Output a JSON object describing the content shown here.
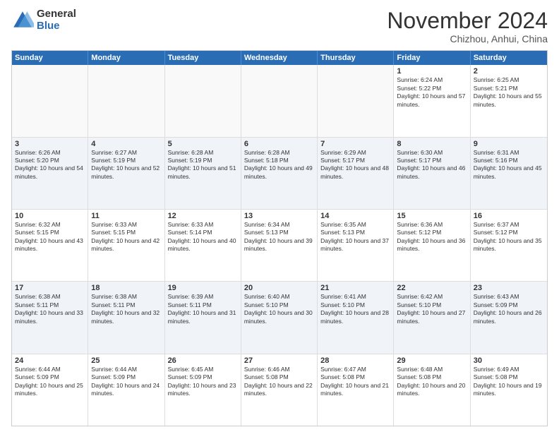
{
  "logo": {
    "general": "General",
    "blue": "Blue"
  },
  "title": "November 2024",
  "location": "Chizhou, Anhui, China",
  "days_of_week": [
    "Sunday",
    "Monday",
    "Tuesday",
    "Wednesday",
    "Thursday",
    "Friday",
    "Saturday"
  ],
  "weeks": [
    [
      {
        "day": "",
        "empty": true
      },
      {
        "day": "",
        "empty": true
      },
      {
        "day": "",
        "empty": true
      },
      {
        "day": "",
        "empty": true
      },
      {
        "day": "",
        "empty": true
      },
      {
        "day": "1",
        "sunrise": "6:24 AM",
        "sunset": "5:22 PM",
        "daylight": "10 hours and 57 minutes."
      },
      {
        "day": "2",
        "sunrise": "6:25 AM",
        "sunset": "5:21 PM",
        "daylight": "10 hours and 55 minutes."
      }
    ],
    [
      {
        "day": "3",
        "sunrise": "6:26 AM",
        "sunset": "5:20 PM",
        "daylight": "10 hours and 54 minutes."
      },
      {
        "day": "4",
        "sunrise": "6:27 AM",
        "sunset": "5:19 PM",
        "daylight": "10 hours and 52 minutes."
      },
      {
        "day": "5",
        "sunrise": "6:28 AM",
        "sunset": "5:19 PM",
        "daylight": "10 hours and 51 minutes."
      },
      {
        "day": "6",
        "sunrise": "6:28 AM",
        "sunset": "5:18 PM",
        "daylight": "10 hours and 49 minutes."
      },
      {
        "day": "7",
        "sunrise": "6:29 AM",
        "sunset": "5:17 PM",
        "daylight": "10 hours and 48 minutes."
      },
      {
        "day": "8",
        "sunrise": "6:30 AM",
        "sunset": "5:17 PM",
        "daylight": "10 hours and 46 minutes."
      },
      {
        "day": "9",
        "sunrise": "6:31 AM",
        "sunset": "5:16 PM",
        "daylight": "10 hours and 45 minutes."
      }
    ],
    [
      {
        "day": "10",
        "sunrise": "6:32 AM",
        "sunset": "5:15 PM",
        "daylight": "10 hours and 43 minutes."
      },
      {
        "day": "11",
        "sunrise": "6:33 AM",
        "sunset": "5:15 PM",
        "daylight": "10 hours and 42 minutes."
      },
      {
        "day": "12",
        "sunrise": "6:33 AM",
        "sunset": "5:14 PM",
        "daylight": "10 hours and 40 minutes."
      },
      {
        "day": "13",
        "sunrise": "6:34 AM",
        "sunset": "5:13 PM",
        "daylight": "10 hours and 39 minutes."
      },
      {
        "day": "14",
        "sunrise": "6:35 AM",
        "sunset": "5:13 PM",
        "daylight": "10 hours and 37 minutes."
      },
      {
        "day": "15",
        "sunrise": "6:36 AM",
        "sunset": "5:12 PM",
        "daylight": "10 hours and 36 minutes."
      },
      {
        "day": "16",
        "sunrise": "6:37 AM",
        "sunset": "5:12 PM",
        "daylight": "10 hours and 35 minutes."
      }
    ],
    [
      {
        "day": "17",
        "sunrise": "6:38 AM",
        "sunset": "5:11 PM",
        "daylight": "10 hours and 33 minutes."
      },
      {
        "day": "18",
        "sunrise": "6:38 AM",
        "sunset": "5:11 PM",
        "daylight": "10 hours and 32 minutes."
      },
      {
        "day": "19",
        "sunrise": "6:39 AM",
        "sunset": "5:11 PM",
        "daylight": "10 hours and 31 minutes."
      },
      {
        "day": "20",
        "sunrise": "6:40 AM",
        "sunset": "5:10 PM",
        "daylight": "10 hours and 30 minutes."
      },
      {
        "day": "21",
        "sunrise": "6:41 AM",
        "sunset": "5:10 PM",
        "daylight": "10 hours and 28 minutes."
      },
      {
        "day": "22",
        "sunrise": "6:42 AM",
        "sunset": "5:10 PM",
        "daylight": "10 hours and 27 minutes."
      },
      {
        "day": "23",
        "sunrise": "6:43 AM",
        "sunset": "5:09 PM",
        "daylight": "10 hours and 26 minutes."
      }
    ],
    [
      {
        "day": "24",
        "sunrise": "6:44 AM",
        "sunset": "5:09 PM",
        "daylight": "10 hours and 25 minutes."
      },
      {
        "day": "25",
        "sunrise": "6:44 AM",
        "sunset": "5:09 PM",
        "daylight": "10 hours and 24 minutes."
      },
      {
        "day": "26",
        "sunrise": "6:45 AM",
        "sunset": "5:09 PM",
        "daylight": "10 hours and 23 minutes."
      },
      {
        "day": "27",
        "sunrise": "6:46 AM",
        "sunset": "5:08 PM",
        "daylight": "10 hours and 22 minutes."
      },
      {
        "day": "28",
        "sunrise": "6:47 AM",
        "sunset": "5:08 PM",
        "daylight": "10 hours and 21 minutes."
      },
      {
        "day": "29",
        "sunrise": "6:48 AM",
        "sunset": "5:08 PM",
        "daylight": "10 hours and 20 minutes."
      },
      {
        "day": "30",
        "sunrise": "6:49 AM",
        "sunset": "5:08 PM",
        "daylight": "10 hours and 19 minutes."
      }
    ]
  ]
}
